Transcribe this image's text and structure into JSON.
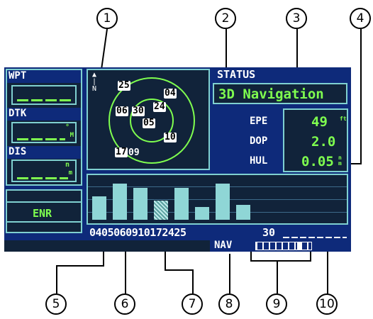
{
  "callouts": [
    "1",
    "2",
    "3",
    "4",
    "5",
    "6",
    "7",
    "8",
    "9",
    "10"
  ],
  "left_panel": {
    "wpt_label": "WPT",
    "dtk_label": "DTK",
    "dtk_unit": "°",
    "dtk_unit2": "M",
    "dis_label": "DIS",
    "dis_unit": "n",
    "dis_unit2": "m",
    "mode": "ENR"
  },
  "sky_view": {
    "north_label": "N",
    "north_icon": "north-arrow-icon",
    "satellites": [
      "25",
      "04",
      "06",
      "30",
      "24",
      "05",
      "10",
      "17",
      "09"
    ]
  },
  "status": {
    "title": "STATUS",
    "value": "3D Navigation",
    "epe_label": "EPE",
    "epe_value": "49",
    "epe_unit": "ft",
    "dop_label": "DOP",
    "dop_value": "2.0",
    "hul_label": "HUL",
    "hul_value": "0.05",
    "hul_unit": "nm"
  },
  "signal_bars": {
    "sat_numbers": "0405060910172425",
    "sat_numbers_tail": "30",
    "levels": [
      0.55,
      0.85,
      0.75,
      0.45,
      0.75,
      0.3,
      0.85,
      0.35
    ],
    "hatched_index": 3
  },
  "status_bar": {
    "mode": "NAV",
    "cdi_icon": "cdi-scale-icon"
  },
  "colors": {
    "screen_bg": "#0e2a7a",
    "cyan": "#7fd0d0",
    "green": "#7fff4f",
    "bar": "#8fd6d6"
  }
}
